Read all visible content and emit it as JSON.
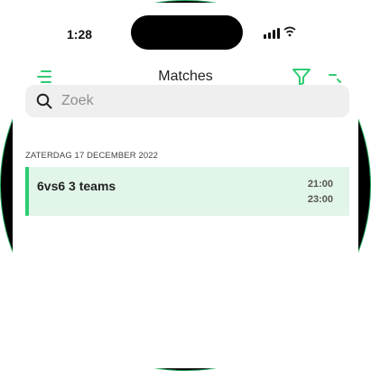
{
  "status_bar": {
    "time": "1:28"
  },
  "header": {
    "title": "Matches",
    "accent_color": "#2ecc71"
  },
  "search": {
    "placeholder": "Zoek",
    "value": ""
  },
  "sections": [
    {
      "header": "ZATERDAG 17 DECEMBER 2022",
      "matches": [
        {
          "name": "6vs6 3 teams",
          "start_time": "21:00",
          "end_time": "23:00",
          "highlight_color": "#e1f5e8"
        }
      ]
    }
  ],
  "icons": {
    "menu": "hamburger-menu-icon",
    "filter": "filter-funnel-icon",
    "more": "more-options-icon",
    "search": "search-icon"
  }
}
